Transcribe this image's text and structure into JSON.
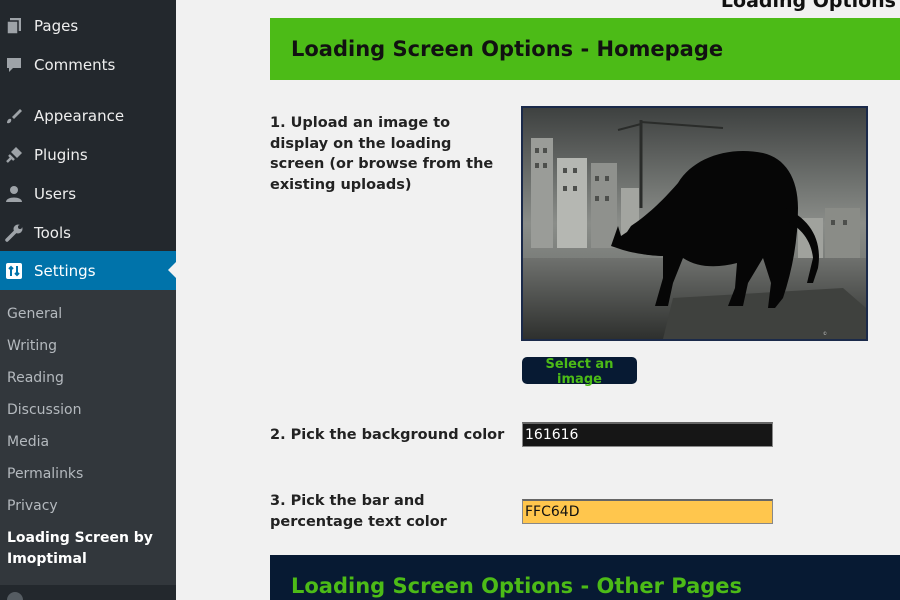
{
  "sidebar": {
    "menu": [
      {
        "label": "Pages",
        "icon": "pages-icon"
      },
      {
        "label": "Comments",
        "icon": "comment-icon"
      },
      {
        "label": "Appearance",
        "icon": "paintbrush-icon"
      },
      {
        "label": "Plugins",
        "icon": "plug-icon"
      },
      {
        "label": "Users",
        "icon": "user-icon"
      },
      {
        "label": "Tools",
        "icon": "wrench-icon"
      },
      {
        "label": "Settings",
        "icon": "settings-icon",
        "active": true
      }
    ],
    "submenu": [
      {
        "label": "General"
      },
      {
        "label": "Writing"
      },
      {
        "label": "Reading"
      },
      {
        "label": "Discussion"
      },
      {
        "label": "Media"
      },
      {
        "label": "Permalinks"
      },
      {
        "label": "Privacy"
      },
      {
        "label": "Loading Screen by Imoptimal",
        "current": true
      }
    ],
    "colors": {
      "bg": "#23282d",
      "submenu_bg": "#32373c",
      "active": "#0073aa"
    }
  },
  "main": {
    "page_title": "Loading Options",
    "homepage_section": {
      "title": "Loading Screen Options - Homepage",
      "color": "#4cbb17"
    },
    "image_option": {
      "label": "1. Upload an image to display on the loading screen (or browse from the existing uploads)",
      "preview_alt": "black cat on a wall in front of buildings",
      "button_label": "Select an image"
    },
    "background_option": {
      "label": "2. Pick the background color",
      "value": "161616",
      "swatch": "#161616"
    },
    "bar_option": {
      "label": "3. Pick the bar and percentage text color",
      "value": "FFC64D",
      "swatch": "#FFC64D"
    },
    "other_pages_section": {
      "title": "Loading Screen Options - Other Pages",
      "color": "#071a33"
    }
  }
}
